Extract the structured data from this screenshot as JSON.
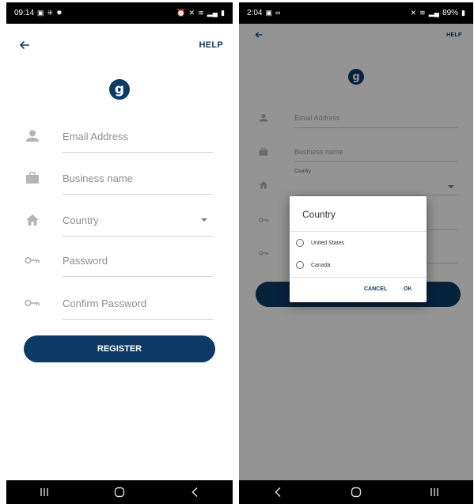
{
  "left": {
    "status": {
      "time": "09:14"
    },
    "header": {
      "help_label": "HELP"
    },
    "logo_letter": "g",
    "fields": {
      "email": "Email Address",
      "business": "Business name",
      "country": "Country",
      "password": "Password",
      "confirm": "Confirm Password"
    },
    "register_label": "REGISTER"
  },
  "right": {
    "status": {
      "time": "2:04",
      "battery": "89%"
    },
    "header": {
      "help_label": "HELP"
    },
    "logo_letter": "g",
    "fields": {
      "email": "Email Address",
      "business": "Business name",
      "country_label": "Country"
    },
    "dialog": {
      "title": "Country",
      "options": [
        "United States",
        "Canada"
      ],
      "cancel": "CANCEL",
      "ok": "OK"
    }
  },
  "colors": {
    "brand": "#0d3b66",
    "statusbar": "#000000",
    "scrim": "rgba(0,0,0,0.42)"
  },
  "icons": [
    "back-arrow-icon",
    "person-icon",
    "briefcase-icon",
    "home-icon",
    "key-icon",
    "chevron-down-icon",
    "recent-apps-icon",
    "home-button-icon",
    "back-nav-icon"
  ]
}
